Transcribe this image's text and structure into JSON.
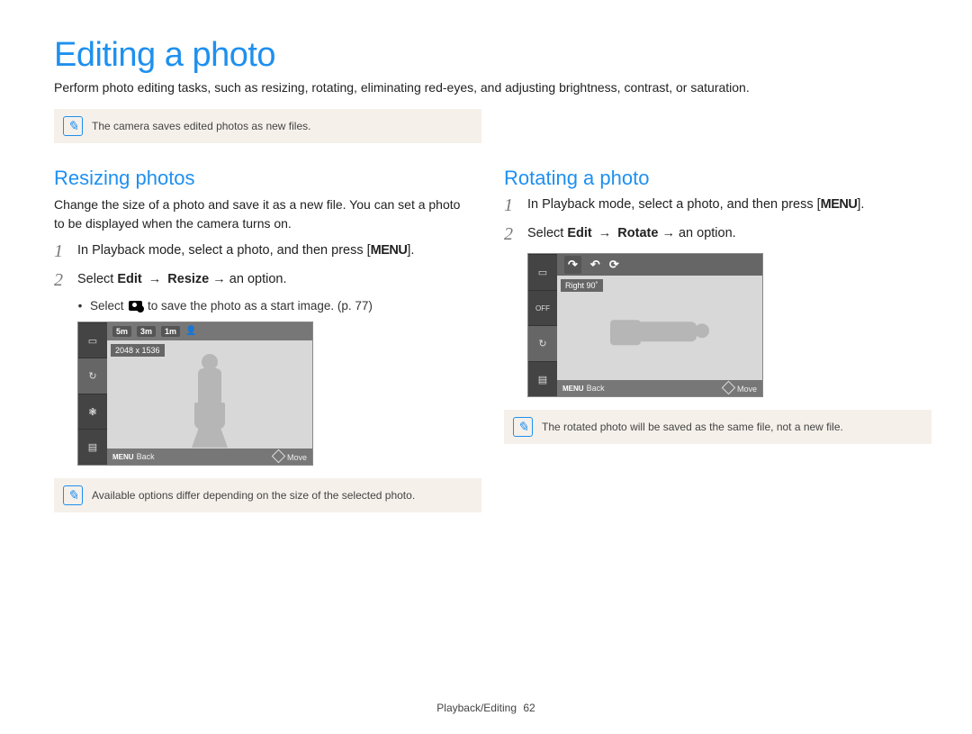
{
  "title": "Editing a photo",
  "intro": "Perform photo editing tasks, such as resizing, rotating, eliminating red-eyes, and adjusting brightness, contrast, or saturation.",
  "top_note": "The camera saves edited photos as new files.",
  "left": {
    "heading": "Resizing photos",
    "body": "Change the size of a photo and save it as a new file. You can set a photo to be displayed when the camera turns on.",
    "step1_a": "In Playback mode, select a photo, and then press [",
    "menu": "MENU",
    "step1_b": "].",
    "step2_a": "Select ",
    "step2_edit": "Edit",
    "step2_arrow": " → ",
    "step2_resize": "Resize",
    "step2_b": " → an option.",
    "bullet_a": "Select ",
    "bullet_b": " to save the photo as a start image. (p. 77)",
    "lcd": {
      "top_5m": "5m",
      "top_3m": "3m",
      "top_1m": "1m",
      "label": "2048 x 1536",
      "back": "Back",
      "move": "Move",
      "menu_small": "MENU"
    },
    "note": "Available options differ depending on the size of the selected photo."
  },
  "right": {
    "heading": "Rotating a photo",
    "step1_a": "In Playback mode, select a photo, and then press [",
    "menu": "MENU",
    "step1_b": "].",
    "step2_a": "Select ",
    "step2_edit": "Edit",
    "step2_arrow": " → ",
    "step2_rotate": "Rotate",
    "step2_b": " → an option.",
    "lcd": {
      "off": "OFF",
      "label": "Right 90˚",
      "back": "Back",
      "move": "Move",
      "menu_small": "MENU"
    },
    "note": "The rotated photo will be saved as the same file, not a new file."
  },
  "footer": {
    "section": "Playback/Editing",
    "page": "62"
  }
}
